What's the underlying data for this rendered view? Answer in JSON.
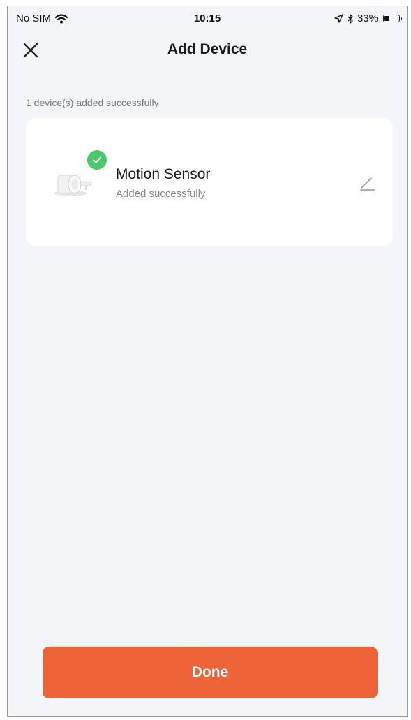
{
  "status_bar": {
    "carrier": "No SIM",
    "time": "10:15",
    "battery_percent": "33%",
    "battery_level": 0.33,
    "icons": [
      "wifi-icon",
      "location-arrow-icon",
      "bluetooth-icon",
      "battery-icon"
    ]
  },
  "header": {
    "title": "Add Device",
    "close_icon": "close-icon"
  },
  "summary": {
    "text": "1 device(s) added successfully"
  },
  "devices": [
    {
      "name": "Motion Sensor",
      "status": "Added successfully",
      "badge_icon": "checkmark-icon",
      "action_icon": "edit-pencil-icon"
    }
  ],
  "actions": {
    "done_label": "Done"
  },
  "colors": {
    "background": "#f4f5f9",
    "card": "#ffffff",
    "accent": "#ee6438",
    "success": "#4cc76e",
    "secondary_text": "#8a8a8a"
  }
}
